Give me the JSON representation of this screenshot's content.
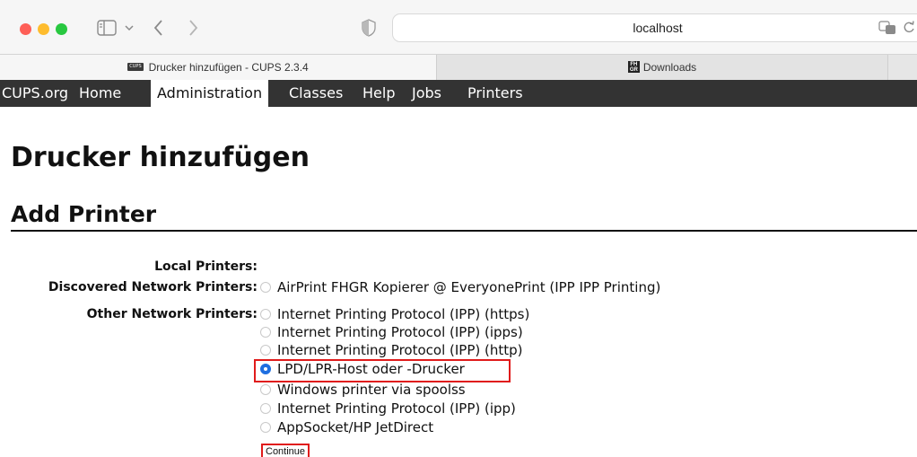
{
  "browser": {
    "url": "localhost",
    "tabs": [
      {
        "label": "Drucker hinzufügen - CUPS 2.3.4",
        "favicon": "CUPS",
        "active": true
      },
      {
        "label": "Downloads",
        "favicon": "FH GR",
        "active": false
      }
    ]
  },
  "cups_nav": {
    "items": [
      {
        "label": "CUPS.org",
        "active": false
      },
      {
        "label": "Home",
        "active": false
      },
      {
        "label": "Administration",
        "active": true
      },
      {
        "label": "Classes",
        "active": false
      },
      {
        "label": "Help",
        "active": false
      },
      {
        "label": "Jobs",
        "active": false
      },
      {
        "label": "Printers",
        "active": false
      }
    ]
  },
  "page": {
    "title": "Drucker hinzufügen",
    "subtitle": "Add Printer",
    "local_label": "Local Printers:",
    "discovered_label": "Discovered Network Printers:",
    "discovered_options": [
      "AirPrint FHGR Kopierer @ EveryonePrint (IPP IPP Printing)"
    ],
    "other_label": "Other Network Printers:",
    "other_options": [
      "Internet Printing Protocol (IPP) (https)",
      "Internet Printing Protocol (IPP) (ipps)",
      "Internet Printing Protocol (IPP) (http)",
      "LPD/LPR-Host oder -Drucker",
      "Windows printer via spoolss",
      "Internet Printing Protocol (IPP) (ipp)",
      "AppSocket/HP JetDirect"
    ],
    "selected_option": "LPD/LPR-Host oder -Drucker",
    "continue_label": "Continue"
  },
  "colors": {
    "nav_bg": "#333333",
    "highlight": "#e01b1b",
    "radio_selected": "#1f6fe0"
  }
}
